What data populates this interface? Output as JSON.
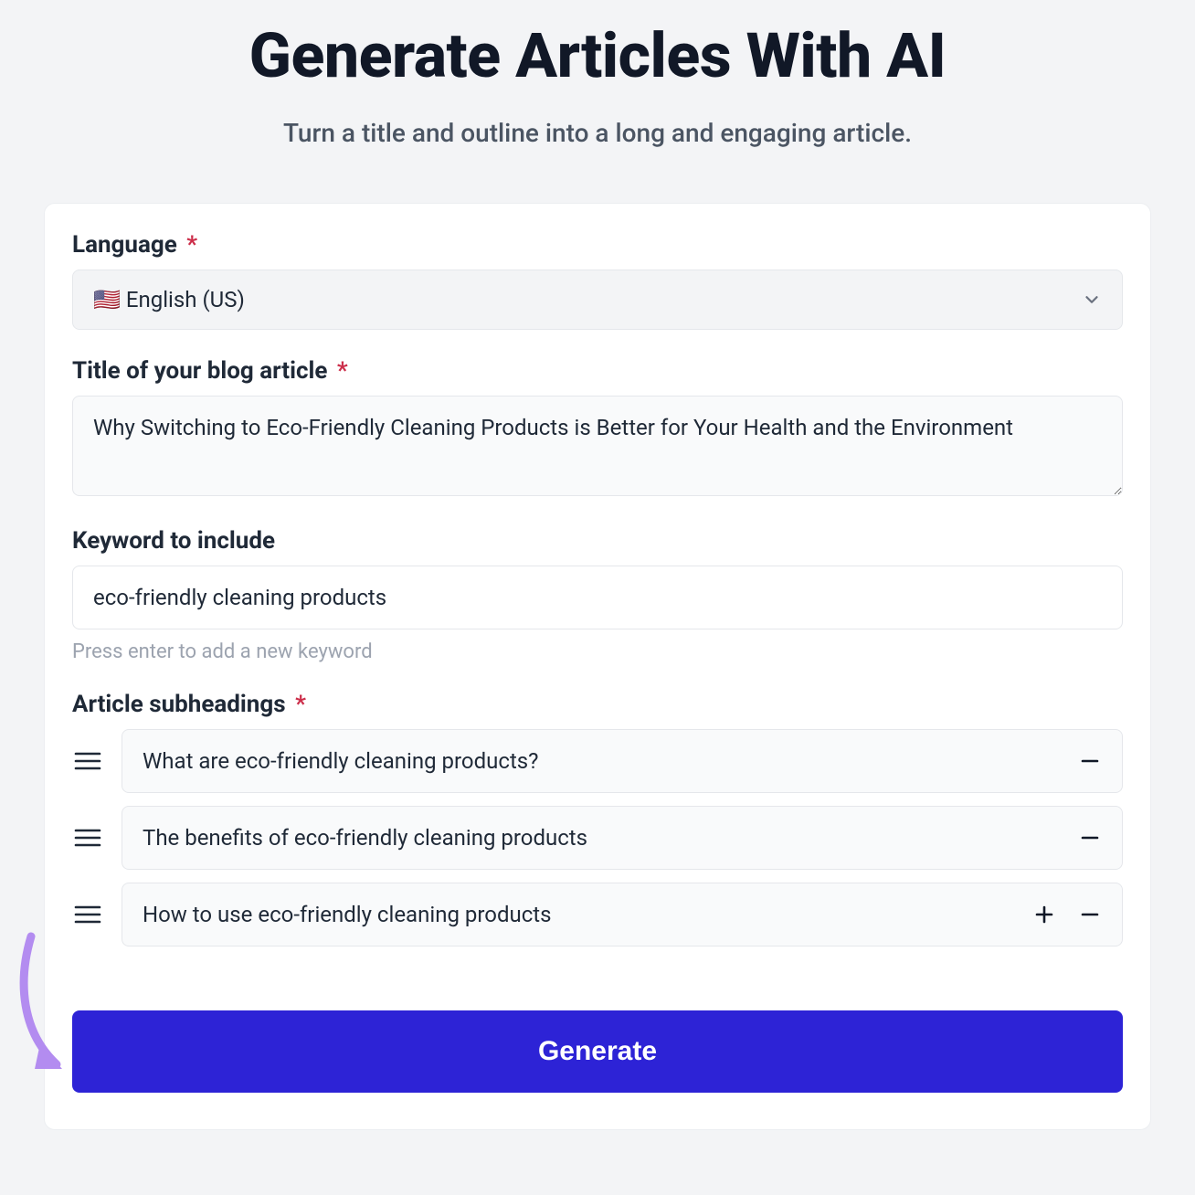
{
  "heading": {
    "title": "Generate Articles With AI",
    "subtitle": "Turn a title and outline into a long and engaging article."
  },
  "form": {
    "language": {
      "label": "Language",
      "required_mark": "*",
      "value": "🇺🇸 English (US)"
    },
    "title": {
      "label": "Title of your blog article",
      "required_mark": "*",
      "value": "Why Switching to Eco-Friendly Cleaning Products is Better for Your Health and the Environment"
    },
    "keyword": {
      "label": "Keyword to include",
      "value": "eco-friendly cleaning products",
      "hint": "Press enter to add a new keyword"
    },
    "subheadings": {
      "label": "Article subheadings",
      "required_mark": "*",
      "items": [
        {
          "value": "What are eco-friendly cleaning products?"
        },
        {
          "value": "The benefits of eco-friendly cleaning products"
        },
        {
          "value": "How to use eco-friendly cleaning products"
        }
      ]
    },
    "generate_label": "Generate"
  },
  "colors": {
    "accent": "#2d23d6",
    "annotation": "#b38cf0"
  }
}
